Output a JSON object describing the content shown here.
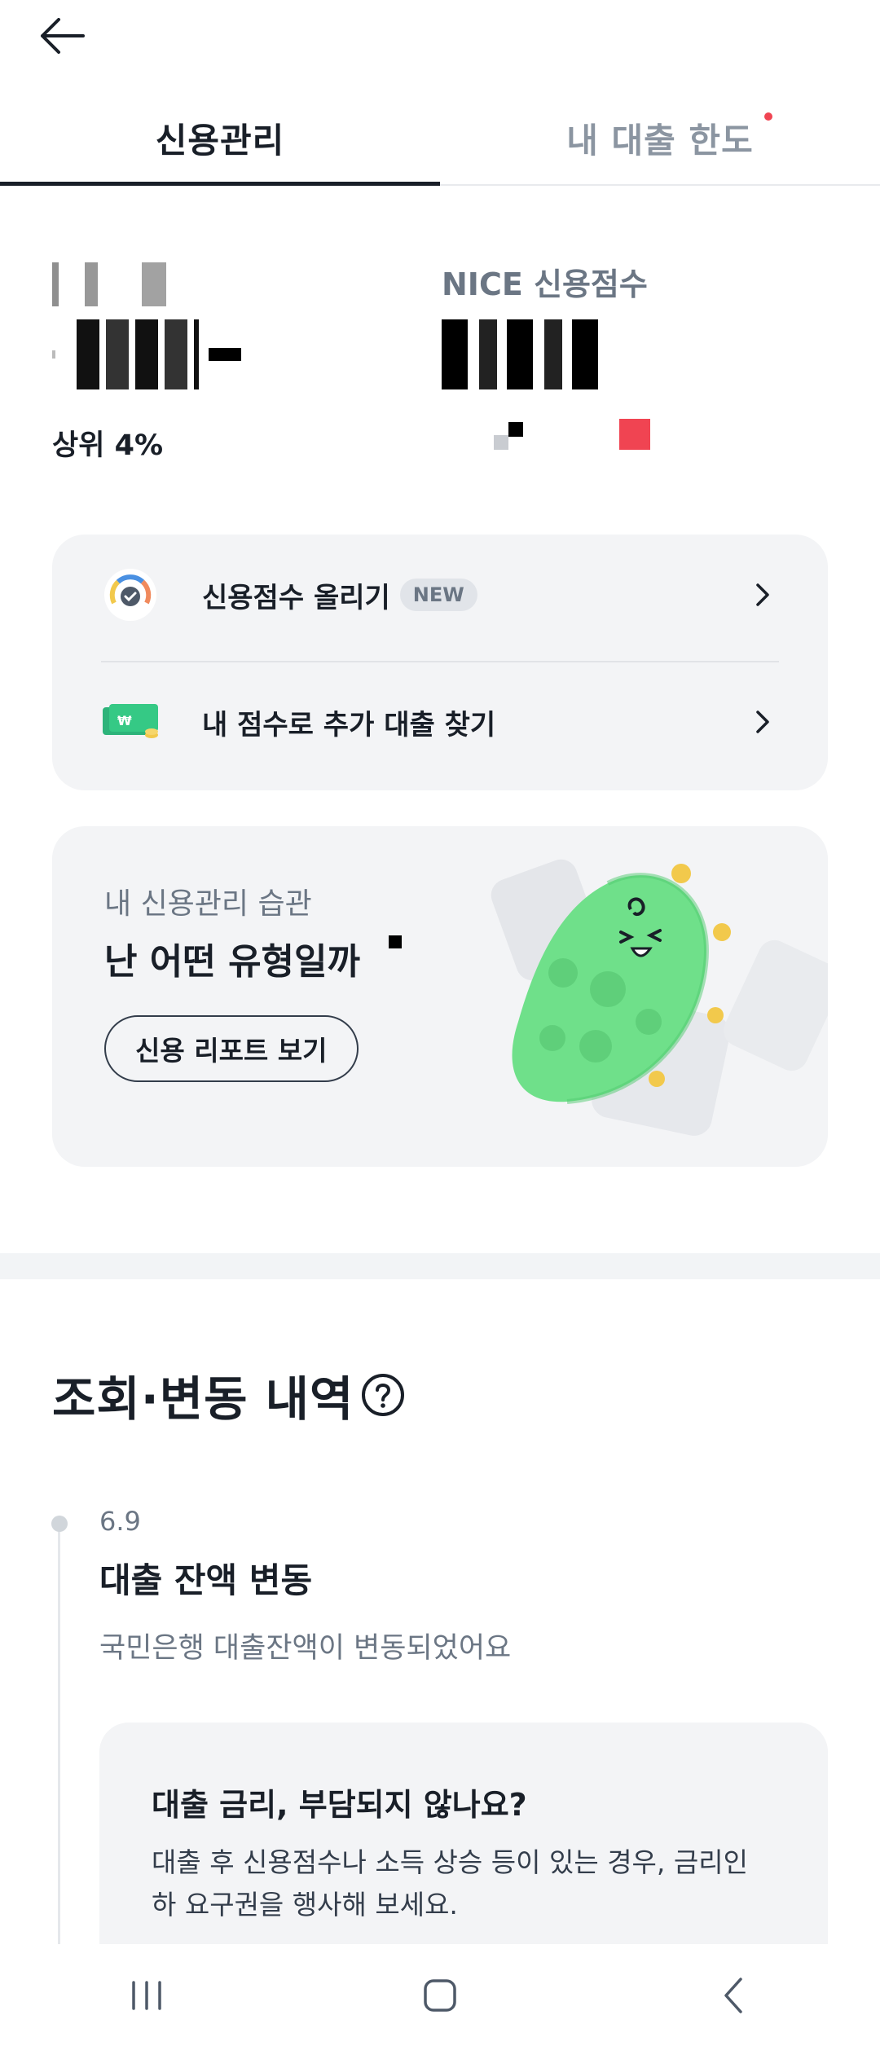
{
  "header": {
    "back_icon": "arrow-left-icon"
  },
  "tabs": [
    {
      "label": "신용관리",
      "active": true
    },
    {
      "label": "내 대출 한도",
      "active": false,
      "has_dot": true
    }
  ],
  "scores": {
    "nice_label": "NICE 신용점수",
    "rank_text": "상위 4%"
  },
  "menu": [
    {
      "label": "신용점수 올리기",
      "badge": "NEW",
      "icon": "gauge-icon"
    },
    {
      "label": "내 점수로 추가 대출 찾기",
      "icon": "money-icon"
    }
  ],
  "habit": {
    "subtitle": "내 신용관리 습관",
    "title": "난 어떤 유형일까",
    "button": "신용 리포트 보기"
  },
  "inquiry": {
    "title": "조회·변동 내역",
    "events": [
      {
        "date": "6.9",
        "title": "대출 잔액 변동",
        "desc": "국민은행 대출잔액이 변동되었어요",
        "tip_title": "대출 금리, 부담되지 않나요?",
        "tip_body": "대출 후 신용점수나 소득 상승 등이 있는 경우, 금리인하 요구권을 행사해 보세요."
      }
    ]
  },
  "colors": {
    "text": "#191f28",
    "muted": "#6b7684",
    "card_bg": "#f3f4f6",
    "dot_red": "#f04452",
    "character_green": "#6fe08a"
  }
}
